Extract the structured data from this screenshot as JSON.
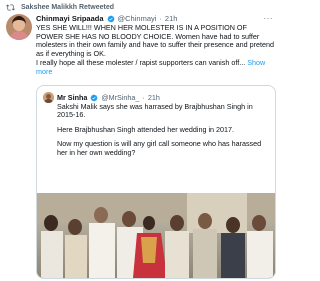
{
  "retweet": {
    "label": "Sakshee Malikkh Retweeted"
  },
  "tweet": {
    "author_name": "Chinmayi Sripaada",
    "handle": "@Chinmayi",
    "separator": "·",
    "time": "21h",
    "more": "···",
    "lines": [
      "YES SHE WILL!!! WHEN HER MOLESTER IS IN A POSITION OF POWER SHE HAS NO BLOODY CHOICE. Women have had to suffer molesters in their own family and have to suffer their presence and pretend as if everything is OK.",
      "I really hope all these molester / rapist supporters can vanish off..."
    ],
    "show_more": "Show more"
  },
  "quote": {
    "author_name": "Mr Sinha",
    "handle": "@MrSinha_",
    "separator": "·",
    "time": "21h",
    "paragraphs": [
      "Sakshi Malik says she was harrased by Brajbhushan Singh in 2015-16.",
      "Here Brajbhushan Singh attended her wedding in 2017.",
      "Now my question is will any girl call someone who has harassed her in her own wedding?"
    ],
    "image_alt": "wedding photo"
  },
  "colors": {
    "accent": "#1d9bf0",
    "muted": "#536471",
    "text": "#0f1419",
    "border": "#cfd9de"
  }
}
